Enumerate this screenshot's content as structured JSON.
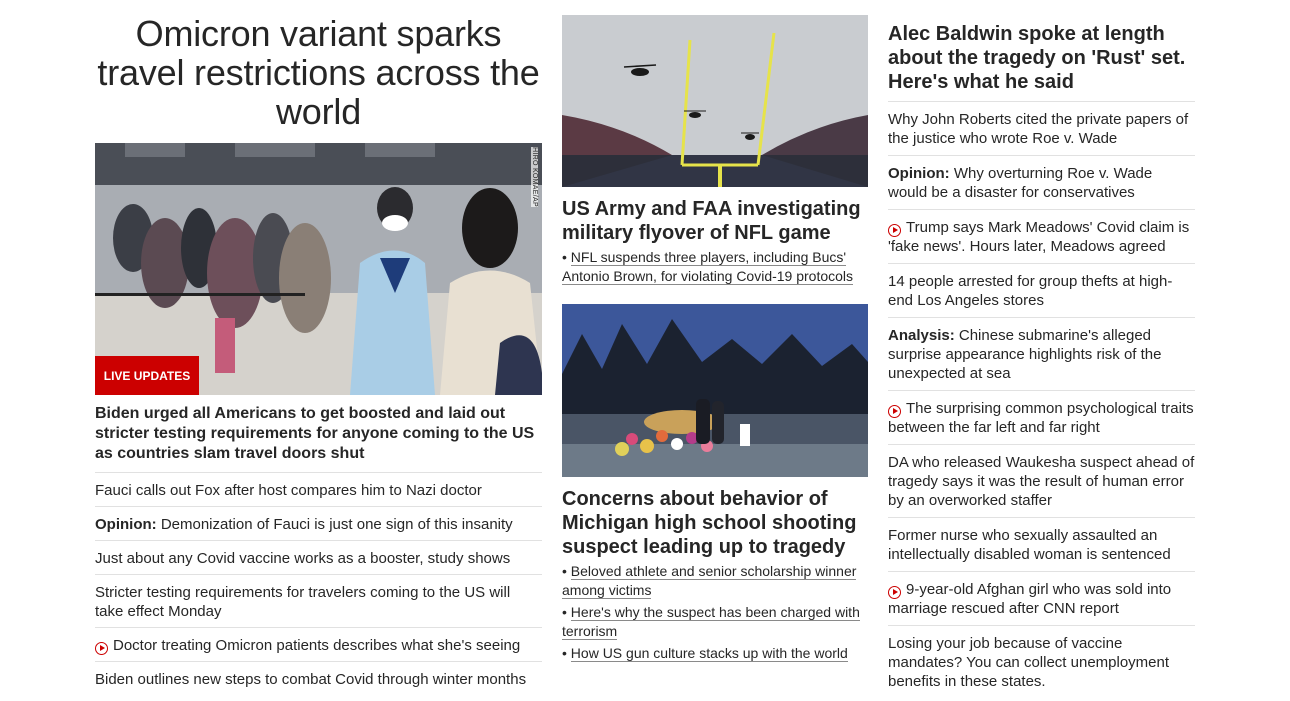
{
  "col1": {
    "headline": "Omicron variant sparks travel restrictions across the world",
    "photo_credit": "HIRO KOMAE/AP",
    "live_badge": "LIVE UPDATES",
    "lead_story": "Biden urged all Americans to get boosted and laid out stricter testing requirements for anyone coming to the US as countries slam travel doors shut",
    "items": [
      {
        "prefix": "",
        "text": "Fauci calls out Fox after host compares him to Nazi doctor",
        "video": false
      },
      {
        "prefix": "Opinion:",
        "text": " Demonization of Fauci is just one sign of this insanity",
        "video": false
      },
      {
        "prefix": "",
        "text": "Just about any Covid vaccine works as a booster, study shows",
        "video": false
      },
      {
        "prefix": "",
        "text": "Stricter testing requirements for travelers coming to the US will take effect Monday",
        "video": false
      },
      {
        "prefix": "",
        "text": "Doctor treating Omicron patients describes what she's seeing",
        "video": true
      },
      {
        "prefix": "",
        "text": "Biden outlines new steps to combat Covid through winter months",
        "video": false
      }
    ]
  },
  "col2": {
    "story1": {
      "title": "US Army and FAA investigating military flyover of NFL game",
      "bullets": [
        "NFL suspends three players, including Bucs' Antonio Brown, for violating Covid-19 protocols"
      ]
    },
    "story2": {
      "title": "Concerns about behavior of Michigan high school shooting suspect leading up to tragedy",
      "bullets": [
        "Beloved athlete and senior scholarship winner among victims",
        "Here's why the suspect has been charged with terrorism",
        "How US gun culture stacks up with the world"
      ]
    }
  },
  "col3": {
    "headline": "Alec Baldwin spoke at length about the tragedy on 'Rust' set. Here's what he said",
    "items": [
      {
        "prefix": "",
        "text": "Why John Roberts cited the private papers of the justice who wrote Roe v. Wade",
        "video": false
      },
      {
        "prefix": "Opinion:",
        "text": " Why overturning Roe v. Wade would be a disaster for conservatives",
        "video": false
      },
      {
        "prefix": "",
        "text": "Trump says Mark Meadows' Covid claim is 'fake news'. Hours later, Meadows agreed",
        "video": true
      },
      {
        "prefix": "",
        "text": "14 people arrested for group thefts at high-end Los Angeles stores",
        "video": false
      },
      {
        "prefix": "Analysis:",
        "text": " Chinese submarine's alleged surprise appearance highlights risk of the unexpected at sea",
        "video": false
      },
      {
        "prefix": "",
        "text": "The surprising common psychological traits between the far left and far right",
        "video": true
      },
      {
        "prefix": "",
        "text": "DA who released Waukesha suspect ahead of tragedy says it was the result of human error by an overworked staffer",
        "video": false
      },
      {
        "prefix": "",
        "text": "Former nurse who sexually assaulted an intellectually disabled woman is sentenced",
        "video": false
      },
      {
        "prefix": "",
        "text": "9-year-old Afghan girl who was sold into marriage rescued after CNN report",
        "video": true
      },
      {
        "prefix": "",
        "text": "Losing your job because of vaccine mandates? You can collect unemployment benefits in these states.",
        "video": false
      }
    ]
  },
  "colors": {
    "accent": "#cc0000",
    "text": "#262626",
    "divider": "#e1e1e1"
  },
  "icons": {
    "video": "play-circle-icon"
  }
}
